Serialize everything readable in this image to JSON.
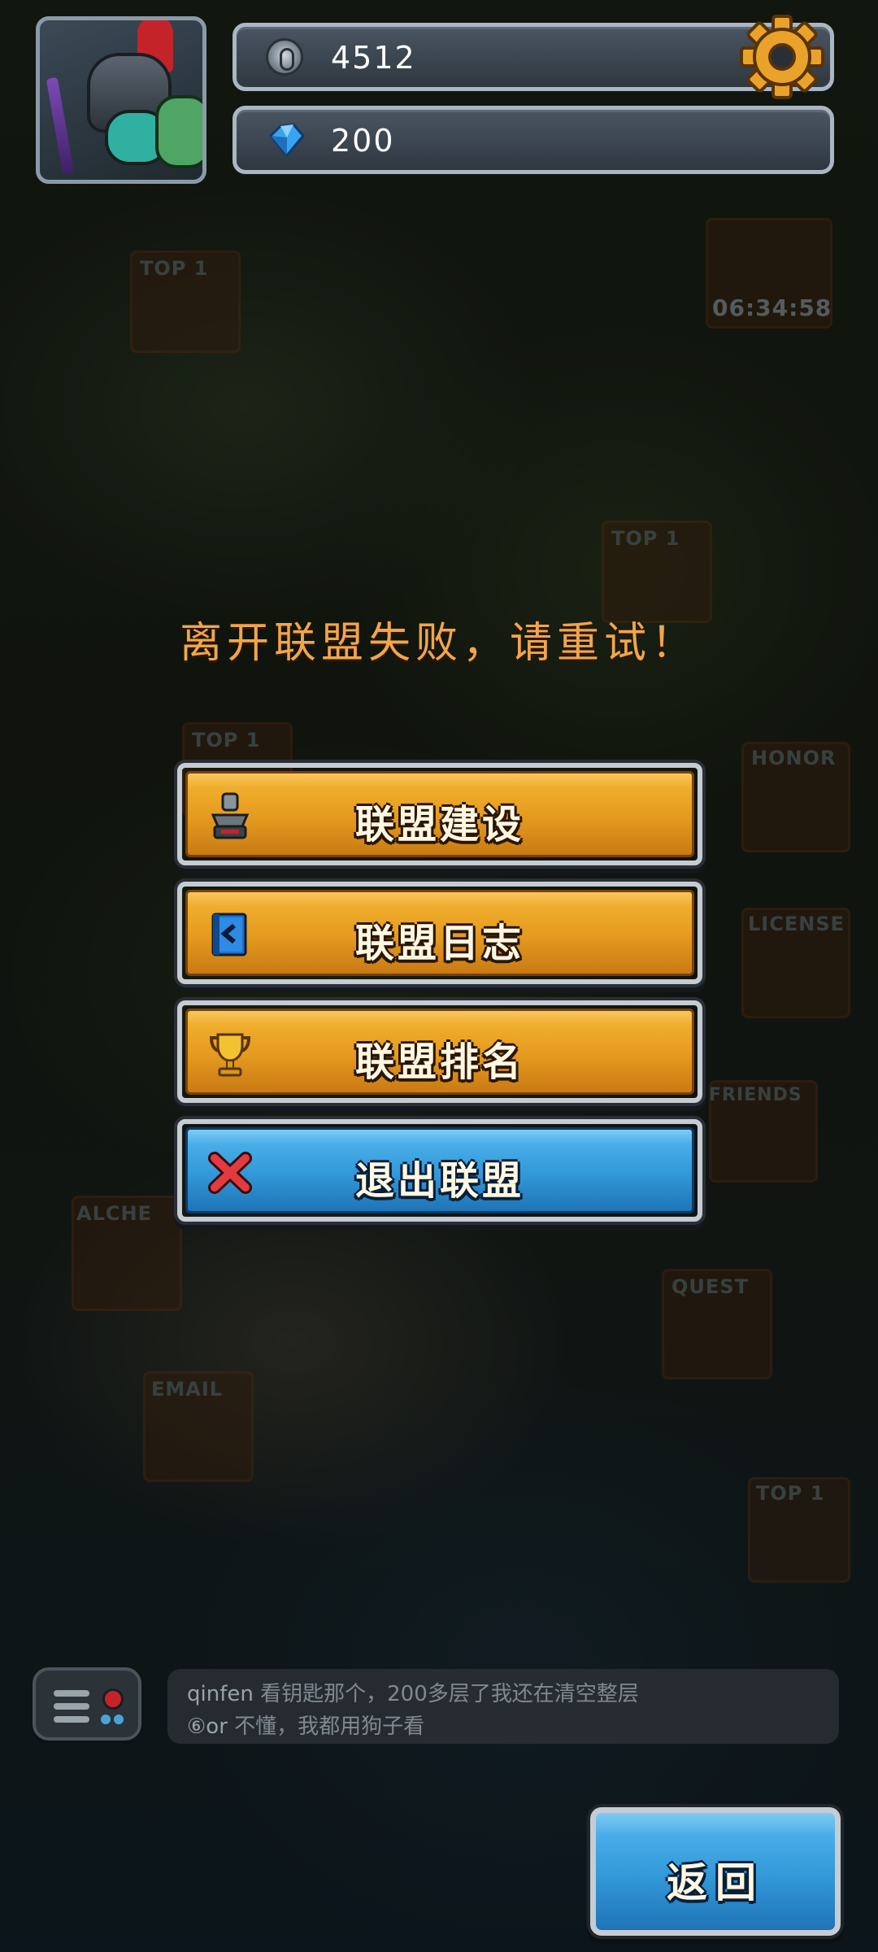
{
  "hud": {
    "coins": "4512",
    "coin_icon": "silver-coin-icon",
    "gems": "200",
    "gem_icon": "blue-gem-icon",
    "settings_icon": "gear-icon"
  },
  "map": {
    "labels": [
      "TOP 1",
      "TOP 1",
      "TOP 1",
      "HONOR",
      "LICENSE",
      "FRIENDS",
      "ALCHE",
      "QUEST",
      "EMAIL",
      "TOP 1"
    ],
    "timer": "06:34:58"
  },
  "message": "离开联盟失败，请重试！",
  "menu": [
    {
      "label": "联盟建设",
      "icon": "anvil-icon",
      "style": "orange"
    },
    {
      "label": "联盟日志",
      "icon": "log-book-icon",
      "style": "orange"
    },
    {
      "label": "联盟排名",
      "icon": "trophy-icon",
      "style": "orange"
    },
    {
      "label": "退出联盟",
      "icon": "close-icon",
      "style": "blue"
    }
  ],
  "chat": {
    "messages": [
      {
        "user": "qinfen",
        "text": "看钥匙那个，200多层了我还在清空整层"
      },
      {
        "user": "⑥or",
        "text": "不懂，我都用狗子看"
      }
    ]
  },
  "back_label": "返回",
  "colors": {
    "message": "#f2a54a",
    "button_orange": "#e49a1f",
    "button_blue": "#3298d8"
  }
}
